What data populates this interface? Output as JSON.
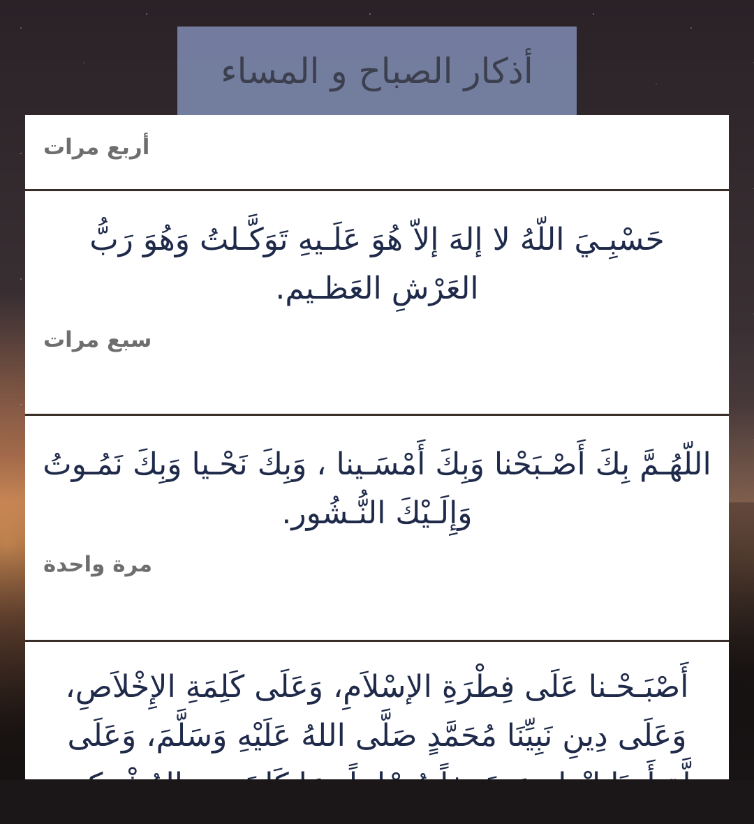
{
  "header": {
    "title": "أذكار الصباح و المساء"
  },
  "entries": [
    {
      "count": "أربع مرات"
    },
    {
      "text": "حَسْبِـيَ اللّهُ لا إلهَ إلاّ هُوَ عَلَـيهِ تَوَكَّـلتُ وَهُوَ رَبُّ العَرْشِ العَظـيم.",
      "count": "سبع مرات"
    },
    {
      "text": "اللّهُـمَّ بِكَ أَصْـبَحْنا وَبِكَ أَمْسَـينا ، وَبِكَ نَحْـيا وَبِكَ نَمُـوتُ وَإِلَـيْكَ النُّـشُور.",
      "count": "مرة واحدة"
    },
    {
      "text": "أَصْبَـحْـنا عَلَى فِطْرَةِ الإسْلاَمِ، وَعَلَى كَلِمَةِ الإِخْلاَصِ، وَعَلَى دِينِ نَبِيِّنَا مُحَمَّدٍ صَلَّى اللهُ عَلَيْهِ وَسَلَّمَ، وَعَلَى مِلَّةِ أَبِينَا إبْرَاهِيمَ حَنِيفاً مُسْلِماً وَمَا كَانَ مِنَ المُشْرِكِينَ."
    }
  ]
}
